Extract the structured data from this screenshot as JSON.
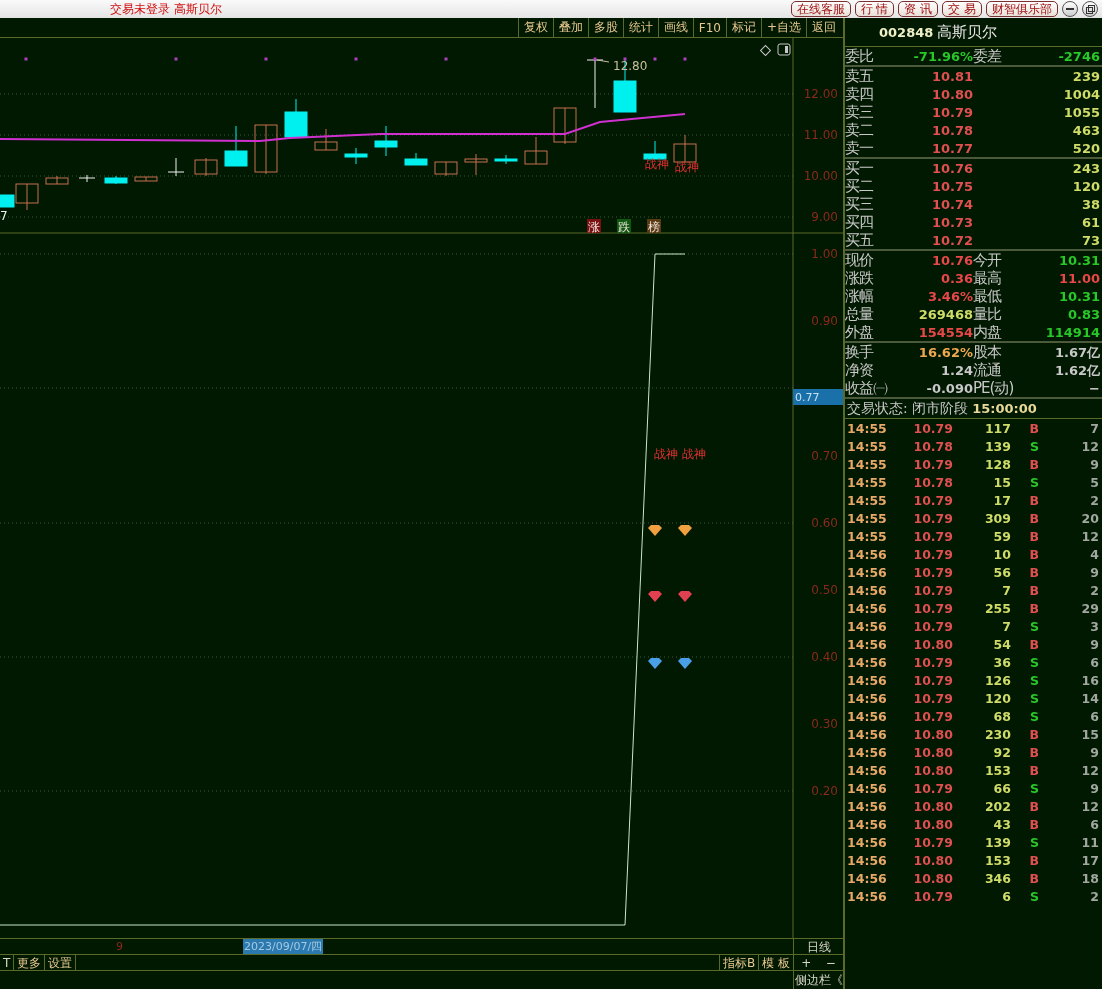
{
  "title_bar": {
    "status": "交易未登录",
    "stock_name": "高斯贝尔",
    "buttons": [
      "在线客服",
      "行 情",
      "资 讯",
      "交 易",
      "财智俱乐部"
    ]
  },
  "toolbar": {
    "buttons": [
      "复权",
      "叠加",
      "多股",
      "统计",
      "画线",
      "F10",
      "标记",
      "+自选",
      "返回"
    ]
  },
  "upper_chart": {
    "edge_label": "7",
    "price_marker": "12.80",
    "signals": [
      "战神",
      "战神"
    ],
    "badges": [
      {
        "text": "涨",
        "color": "#7a1010"
      },
      {
        "text": "跌",
        "color": "#105a10"
      },
      {
        "text": "榜",
        "color": "#5a3a10"
      }
    ],
    "axis_labels": [
      "12.00",
      "11.00",
      "10.00",
      "9.00"
    ]
  },
  "lower_chart": {
    "current_marker": "0.77",
    "signals": [
      "战神",
      "战神"
    ],
    "gems": [
      {
        "color": "#f0a040"
      },
      {
        "color": "#e04050"
      },
      {
        "color": "#4aa0e8"
      }
    ],
    "axis_labels": [
      "1.00",
      "0.90",
      "0.70",
      "0.60",
      "0.50",
      "0.40",
      "0.30",
      "0.20"
    ]
  },
  "date_strip": {
    "tick": "9",
    "cursor_date": "2023/09/07/四",
    "period": "日线"
  },
  "bottom_bar": {
    "left_buttons": [
      "T",
      "更多",
      "设置"
    ],
    "right_buttons": [
      "指标B",
      "模 板"
    ],
    "zoom_buttons": [
      "+",
      "−"
    ],
    "sidebar_toggle": "侧边栏《"
  },
  "quote_panel": {
    "code": "002848",
    "name": "高斯贝尔",
    "order_ratio": [
      {
        "label": "委比",
        "value": "-71.96%",
        "color": "#28c828"
      },
      {
        "label": "委差",
        "value": "-2746",
        "color": "#28c828"
      }
    ],
    "asks": [
      {
        "label": "卖五",
        "price": "10.81",
        "volume": "239"
      },
      {
        "label": "卖四",
        "price": "10.80",
        "volume": "1004"
      },
      {
        "label": "卖三",
        "price": "10.79",
        "volume": "1055"
      },
      {
        "label": "卖二",
        "price": "10.78",
        "volume": "463"
      },
      {
        "label": "卖一",
        "price": "10.77",
        "volume": "520"
      }
    ],
    "bids": [
      {
        "label": "买一",
        "price": "10.76",
        "volume": "243"
      },
      {
        "label": "买二",
        "price": "10.75",
        "volume": "120"
      },
      {
        "label": "买三",
        "price": "10.74",
        "volume": "38"
      },
      {
        "label": "买四",
        "price": "10.73",
        "volume": "61"
      },
      {
        "label": "买五",
        "price": "10.72",
        "volume": "73"
      }
    ],
    "stats": [
      [
        {
          "label": "现价",
          "value": "10.76",
          "color": "#e84848"
        },
        {
          "label": "今开",
          "value": "10.31",
          "color": "#28c828"
        }
      ],
      [
        {
          "label": "涨跌",
          "value": "0.36",
          "color": "#e84848"
        },
        {
          "label": "最高",
          "value": "11.00",
          "color": "#e84848"
        }
      ],
      [
        {
          "label": "涨幅",
          "value": "3.46%",
          "color": "#e84848"
        },
        {
          "label": "最低",
          "value": "10.31",
          "color": "#28c828"
        }
      ],
      [
        {
          "label": "总量",
          "value": "269468",
          "color": "#d0dc68"
        },
        {
          "label": "量比",
          "value": "0.83",
          "color": "#28c828"
        }
      ],
      [
        {
          "label": "外盘",
          "value": "154554",
          "color": "#e84848"
        },
        {
          "label": "内盘",
          "value": "114914",
          "color": "#28c828"
        }
      ]
    ],
    "fundamentals": [
      [
        {
          "label": "换手",
          "value": "16.62%",
          "color": "#f0a850"
        },
        {
          "label": "股本",
          "value": "1.67亿",
          "color": "#c8c8c8"
        }
      ],
      [
        {
          "label": "净资",
          "value": "1.24",
          "color": "#c8c8c8"
        },
        {
          "label": "流通",
          "value": "1.62亿",
          "color": "#c8c8c8"
        }
      ],
      [
        {
          "label": "收益㈠",
          "value": "-0.090",
          "color": "#c8c8c8"
        },
        {
          "label": "PE(动)",
          "value": "−",
          "color": "#c8c8c8"
        }
      ]
    ],
    "trade_status": {
      "label": "交易状态: 闭市阶段",
      "time": "15:00:00"
    },
    "ticks": [
      {
        "time": "14:55",
        "price": "10.79",
        "volume": "117",
        "side": "B",
        "kind": "buy",
        "count": "7"
      },
      {
        "time": "14:55",
        "price": "10.78",
        "volume": "139",
        "side": "S",
        "kind": "sell",
        "count": "12"
      },
      {
        "time": "14:55",
        "price": "10.79",
        "volume": "128",
        "side": "B",
        "kind": "buy",
        "count": "9"
      },
      {
        "time": "14:55",
        "price": "10.78",
        "volume": "15",
        "side": "S",
        "kind": "sell",
        "count": "5"
      },
      {
        "time": "14:55",
        "price": "10.79",
        "volume": "17",
        "side": "B",
        "kind": "buy",
        "count": "2"
      },
      {
        "time": "14:55",
        "price": "10.79",
        "volume": "309",
        "side": "B",
        "kind": "buy",
        "count": "20"
      },
      {
        "time": "14:55",
        "price": "10.79",
        "volume": "59",
        "side": "B",
        "kind": "buy",
        "count": "12"
      },
      {
        "time": "14:56",
        "price": "10.79",
        "volume": "10",
        "side": "B",
        "kind": "buy",
        "count": "4"
      },
      {
        "time": "14:56",
        "price": "10.79",
        "volume": "56",
        "side": "B",
        "kind": "buy",
        "count": "9"
      },
      {
        "time": "14:56",
        "price": "10.79",
        "volume": "7",
        "side": "B",
        "kind": "buy",
        "count": "2"
      },
      {
        "time": "14:56",
        "price": "10.79",
        "volume": "255",
        "side": "B",
        "kind": "buy",
        "count": "29"
      },
      {
        "time": "14:56",
        "price": "10.79",
        "volume": "7",
        "side": "S",
        "kind": "sell",
        "count": "3"
      },
      {
        "time": "14:56",
        "price": "10.80",
        "volume": "54",
        "side": "B",
        "kind": "buy",
        "count": "9"
      },
      {
        "time": "14:56",
        "price": "10.79",
        "volume": "36",
        "side": "S",
        "kind": "sell",
        "count": "6"
      },
      {
        "time": "14:56",
        "price": "10.79",
        "volume": "126",
        "side": "S",
        "kind": "sell",
        "count": "16"
      },
      {
        "time": "14:56",
        "price": "10.79",
        "volume": "120",
        "side": "S",
        "kind": "sell",
        "count": "14"
      },
      {
        "time": "14:56",
        "price": "10.79",
        "volume": "68",
        "side": "S",
        "kind": "sell",
        "count": "6"
      },
      {
        "time": "14:56",
        "price": "10.80",
        "volume": "230",
        "side": "B",
        "kind": "buy",
        "count": "15"
      },
      {
        "time": "14:56",
        "price": "10.80",
        "volume": "92",
        "side": "B",
        "kind": "buy",
        "count": "9"
      },
      {
        "time": "14:56",
        "price": "10.80",
        "volume": "153",
        "side": "B",
        "kind": "buy",
        "count": "12"
      },
      {
        "time": "14:56",
        "price": "10.79",
        "volume": "66",
        "side": "S",
        "kind": "sell",
        "count": "9"
      },
      {
        "time": "14:56",
        "price": "10.80",
        "volume": "202",
        "side": "B",
        "kind": "buy",
        "count": "12"
      },
      {
        "time": "14:56",
        "price": "10.80",
        "volume": "43",
        "side": "B",
        "kind": "buy",
        "count": "6"
      },
      {
        "time": "14:56",
        "price": "10.79",
        "volume": "139",
        "side": "S",
        "kind": "sell",
        "count": "11"
      },
      {
        "time": "14:56",
        "price": "10.80",
        "volume": "153",
        "side": "B",
        "kind": "buy",
        "count": "17"
      },
      {
        "time": "14:56",
        "price": "10.80",
        "volume": "346",
        "side": "B",
        "kind": "buy",
        "count": "18"
      },
      {
        "time": "14:56",
        "price": "10.79",
        "volume": "6",
        "side": "S",
        "kind": "sell",
        "count": "2"
      }
    ]
  }
}
